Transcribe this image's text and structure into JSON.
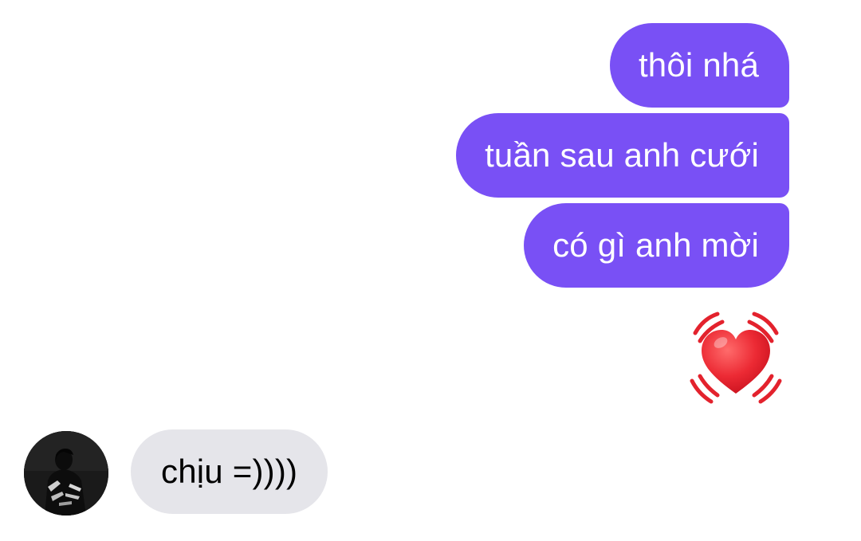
{
  "messages": {
    "outgoing": [
      {
        "text": "thôi nhá"
      },
      {
        "text": "tuần sau anh cưới"
      },
      {
        "text": "có gì anh mời"
      }
    ],
    "reaction": {
      "icon": "beating-heart-icon",
      "color": "#e8242f"
    },
    "incoming": [
      {
        "text": "chịu =))))"
      }
    ]
  },
  "theme": {
    "outgoing_bubble": "#7950f5",
    "incoming_bubble": "#e5e5ea",
    "outgoing_text": "#ffffff",
    "incoming_text": "#000000"
  }
}
